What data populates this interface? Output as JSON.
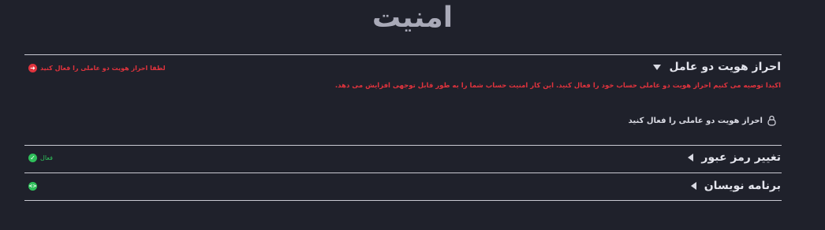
{
  "page": {
    "title": "امنیت"
  },
  "two_factor": {
    "header": "احراز هویت دو عامل",
    "status_text": "لطفا احراز هویت دو عاملی را فعال کنید",
    "warning": "اکیدا توصیه می کنیم احراز هویت دو عاملی حساب خود را فعال کنید. این کار امنیت حساب شما را به طور قابل توجهی افزایش می دهد.",
    "enable_label": "احراز هویت دو عاملی را فعال کنید",
    "status_color": "#e0333d",
    "icon": "lock-icon"
  },
  "change_password": {
    "header": "تغییر رمز عبور",
    "status_text": "فعال",
    "status_color": "#2fbf5a"
  },
  "developers": {
    "header": "برنامه نویسان",
    "status_color": "#2fbf5a",
    "icon": "code-icon"
  }
}
